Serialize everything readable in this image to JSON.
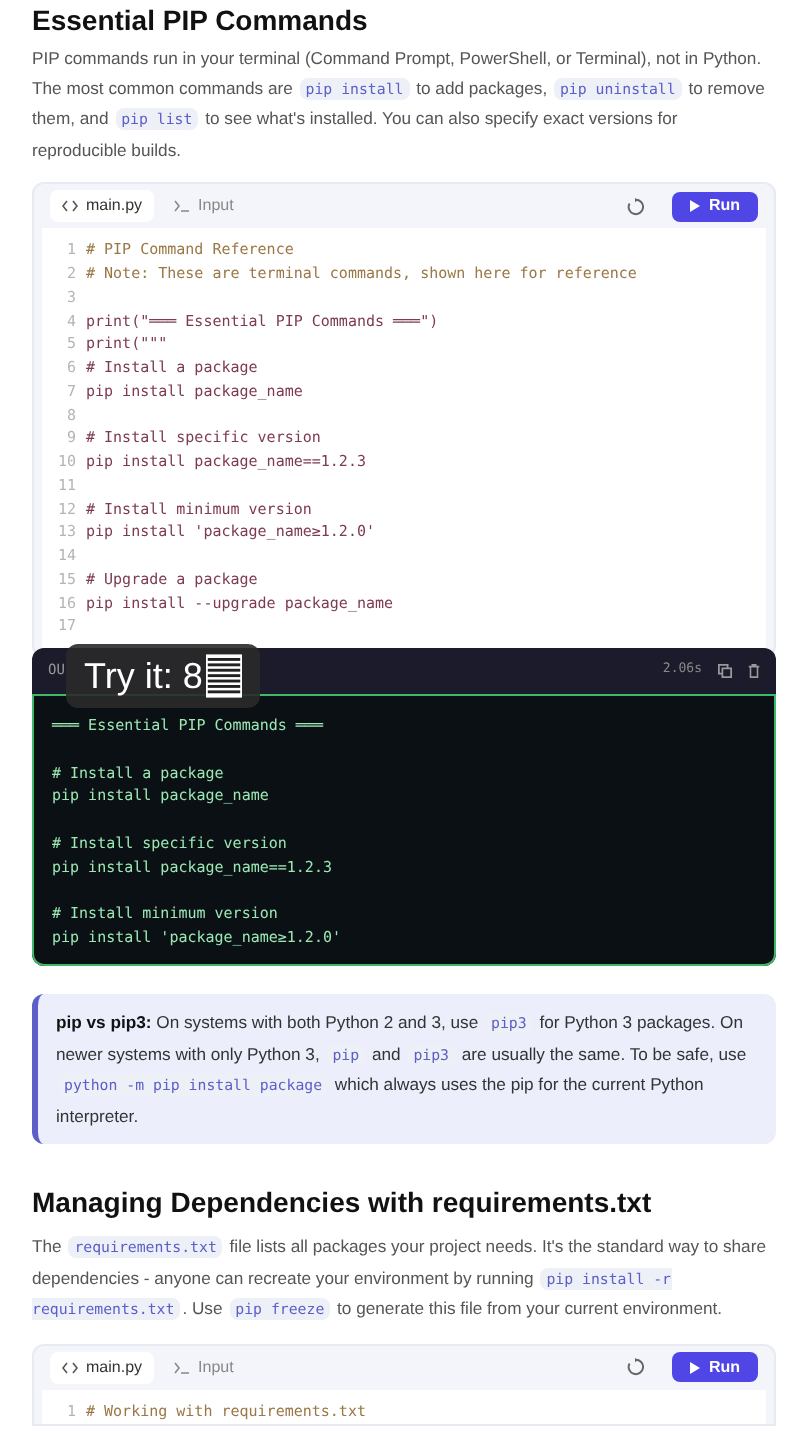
{
  "heading": "Essential PIP Commands",
  "intro": [
    {
      "kind": "text",
      "text": "PIP commands run in your terminal (Command Prompt, PowerShell, or Terminal), not in Python. The most common commands are "
    },
    {
      "kind": "code",
      "text": "pip install"
    },
    {
      "kind": "text",
      "text": " to add packages, "
    },
    {
      "kind": "code",
      "text": "pip uninstall"
    },
    {
      "kind": "text",
      "text": " to remove them, and "
    },
    {
      "kind": "code",
      "text": "pip list"
    },
    {
      "kind": "text",
      "text": " to see what's installed. You can also specify exact versions for reproducible builds."
    }
  ],
  "editor1": {
    "tabs": [
      {
        "label": "main.py",
        "selected": true
      },
      {
        "label": "Input",
        "selected": false
      }
    ],
    "run": "Run",
    "lines": [
      {
        "n": "1",
        "kind": "comment",
        "text": "# PIP Command Reference"
      },
      {
        "n": "2",
        "kind": "comment",
        "text": "# Note: These are terminal commands, shown here for reference"
      },
      {
        "n": "3"
      },
      {
        "n": "4",
        "kind": "code",
        "text": "print(\"═══ Essential PIP Commands ═══\")"
      },
      {
        "n": "5",
        "kind": "code",
        "text": "print(\"\"\""
      },
      {
        "n": "6",
        "kind": "code",
        "text": "# Install a package"
      },
      {
        "n": "7",
        "kind": "code",
        "text": "pip install package_name"
      },
      {
        "n": "8"
      },
      {
        "n": "9",
        "kind": "code",
        "text": "# Install specific version"
      },
      {
        "n": "10",
        "kind": "code",
        "text": "pip install package_name==1.2.3"
      },
      {
        "n": "11"
      },
      {
        "n": "12",
        "kind": "code",
        "text": "# Install minimum version"
      },
      {
        "n": "13",
        "kind": "code",
        "text": "pip install 'package_name≥1.2.0'"
      },
      {
        "n": "14"
      },
      {
        "n": "15",
        "kind": "code",
        "text": "# Upgrade a package"
      },
      {
        "n": "16",
        "kind": "code",
        "text": "pip install --upgrade package_name"
      },
      {
        "n": "17"
      }
    ]
  },
  "output": {
    "label": "OU",
    "time": "2.06s",
    "lines": [
      {
        "text": "═══ Essential PIP Commands ═══",
        "gap_before": false
      },
      {
        "text": "# Install a package",
        "gap_before": true
      },
      {
        "text": "pip install package_name",
        "gap_before": false
      },
      {
        "text": "# Install specific version",
        "gap_before": true
      },
      {
        "text": "pip install package_name==1.2.3",
        "gap_before": false
      },
      {
        "text": "# Install minimum version",
        "gap_before": true
      },
      {
        "text": "pip install 'package_name≥1.2.0'",
        "gap_before": false
      }
    ]
  },
  "overlay": {
    "text": "Try it: 8"
  },
  "note": [
    {
      "kind": "bold",
      "text": "pip vs pip3:"
    },
    {
      "kind": "text",
      "text": " On systems with both Python 2 and 3, use "
    },
    {
      "kind": "code",
      "text": "pip3"
    },
    {
      "kind": "text",
      "text": " for Python 3 packages. On newer systems with only Python 3, "
    },
    {
      "kind": "code",
      "text": "pip"
    },
    {
      "kind": "text",
      "text": " and "
    },
    {
      "kind": "code",
      "text": "pip3"
    },
    {
      "kind": "text",
      "text": " are usually the same. To be safe, use "
    },
    {
      "kind": "code",
      "text": "python -m pip install package"
    },
    {
      "kind": "text",
      "text": " which always uses the pip for the current Python interpreter."
    }
  ],
  "heading2": "Managing Dependencies with requirements.txt",
  "para2": [
    {
      "kind": "text",
      "text": "The "
    },
    {
      "kind": "code",
      "text": "requirements.txt"
    },
    {
      "kind": "text",
      "text": " file lists all packages your project needs. It's the standard way to share dependencies - anyone can recreate your environment by running "
    },
    {
      "kind": "code",
      "text": "pip install -r requirements.txt"
    },
    {
      "kind": "text",
      "text": ". Use "
    },
    {
      "kind": "code",
      "text": "pip freeze"
    },
    {
      "kind": "text",
      "text": " to generate this file from your current environment."
    }
  ],
  "editor2": {
    "tabs": [
      {
        "label": "main.py",
        "selected": true
      },
      {
        "label": "Input",
        "selected": false
      }
    ],
    "run": "Run",
    "lines": [
      {
        "n": "1",
        "kind": "comment",
        "text": "# Working with requirements.txt"
      }
    ]
  }
}
